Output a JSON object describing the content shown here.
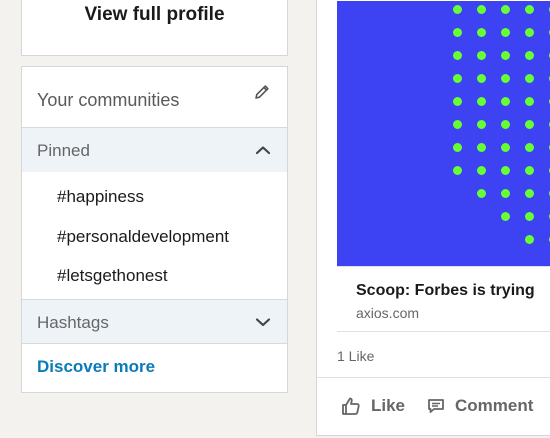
{
  "profile": {
    "view_full_profile": "View full profile"
  },
  "communities": {
    "title": "Your communities",
    "edit_icon": "pencil-icon",
    "pinned": {
      "label": "Pinned",
      "expanded": true,
      "tags": [
        "#happiness",
        "#personaldevelopment",
        "#letsgethonest"
      ]
    },
    "hashtags": {
      "label": "Hashtags",
      "expanded": false
    },
    "discover_more": "Discover more"
  },
  "post": {
    "image": {
      "background": "#3d42f2",
      "dot_color": "#66ff33"
    },
    "link_title": "Scoop: Forbes is trying",
    "link_source": "axios.com",
    "likes_count": "1 Like",
    "actions": {
      "like": "Like",
      "comment": "Comment"
    }
  },
  "colors": {
    "link_blue": "#0a7bb8",
    "section_bg": "#eef3f8",
    "page_bg": "#f3f2ef"
  }
}
